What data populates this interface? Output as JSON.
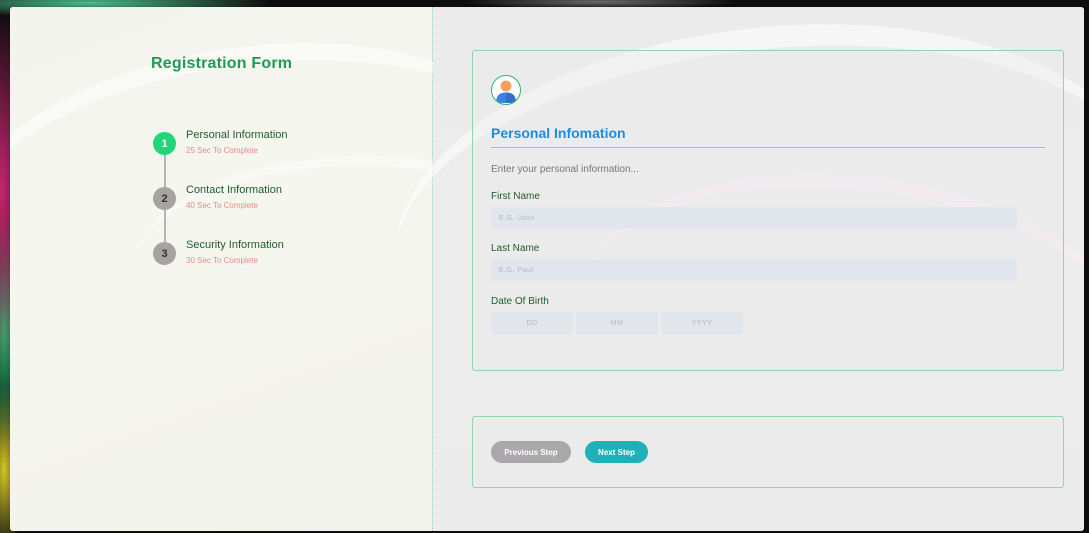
{
  "sidebar": {
    "title": "Registration Form",
    "steps": [
      {
        "number": "1",
        "title": "Personal Information",
        "subtitle": "25 Sec To Complete",
        "active": true
      },
      {
        "number": "2",
        "title": "Contact Information",
        "subtitle": "40 Sec To Complete",
        "active": false
      },
      {
        "number": "3",
        "title": "Security Information",
        "subtitle": "30 Sec To Complete",
        "active": false
      }
    ]
  },
  "form": {
    "icon": "user-avatar-icon",
    "section_title": "Personal Infomation",
    "intro": "Enter your personal information...",
    "first_name": {
      "label": "First Name",
      "placeholder": "E.G. John",
      "value": ""
    },
    "last_name": {
      "label": "Last Name",
      "placeholder": "E.G. Paul",
      "value": ""
    },
    "dob": {
      "label": "Date Of Birth",
      "day_placeholder": "DD",
      "month_placeholder": "MM",
      "year_placeholder": "YYYY"
    }
  },
  "actions": {
    "prev_label": "Previous Step",
    "next_label": "Next Step"
  },
  "colors": {
    "accent_green": "#1f9a55",
    "active_step": "#22d47a",
    "inactive_step": "#a7a3a1",
    "section_title_blue": "#1f8be0",
    "next_button": "#1eb1b8",
    "prev_button": "#aaa8aa"
  }
}
